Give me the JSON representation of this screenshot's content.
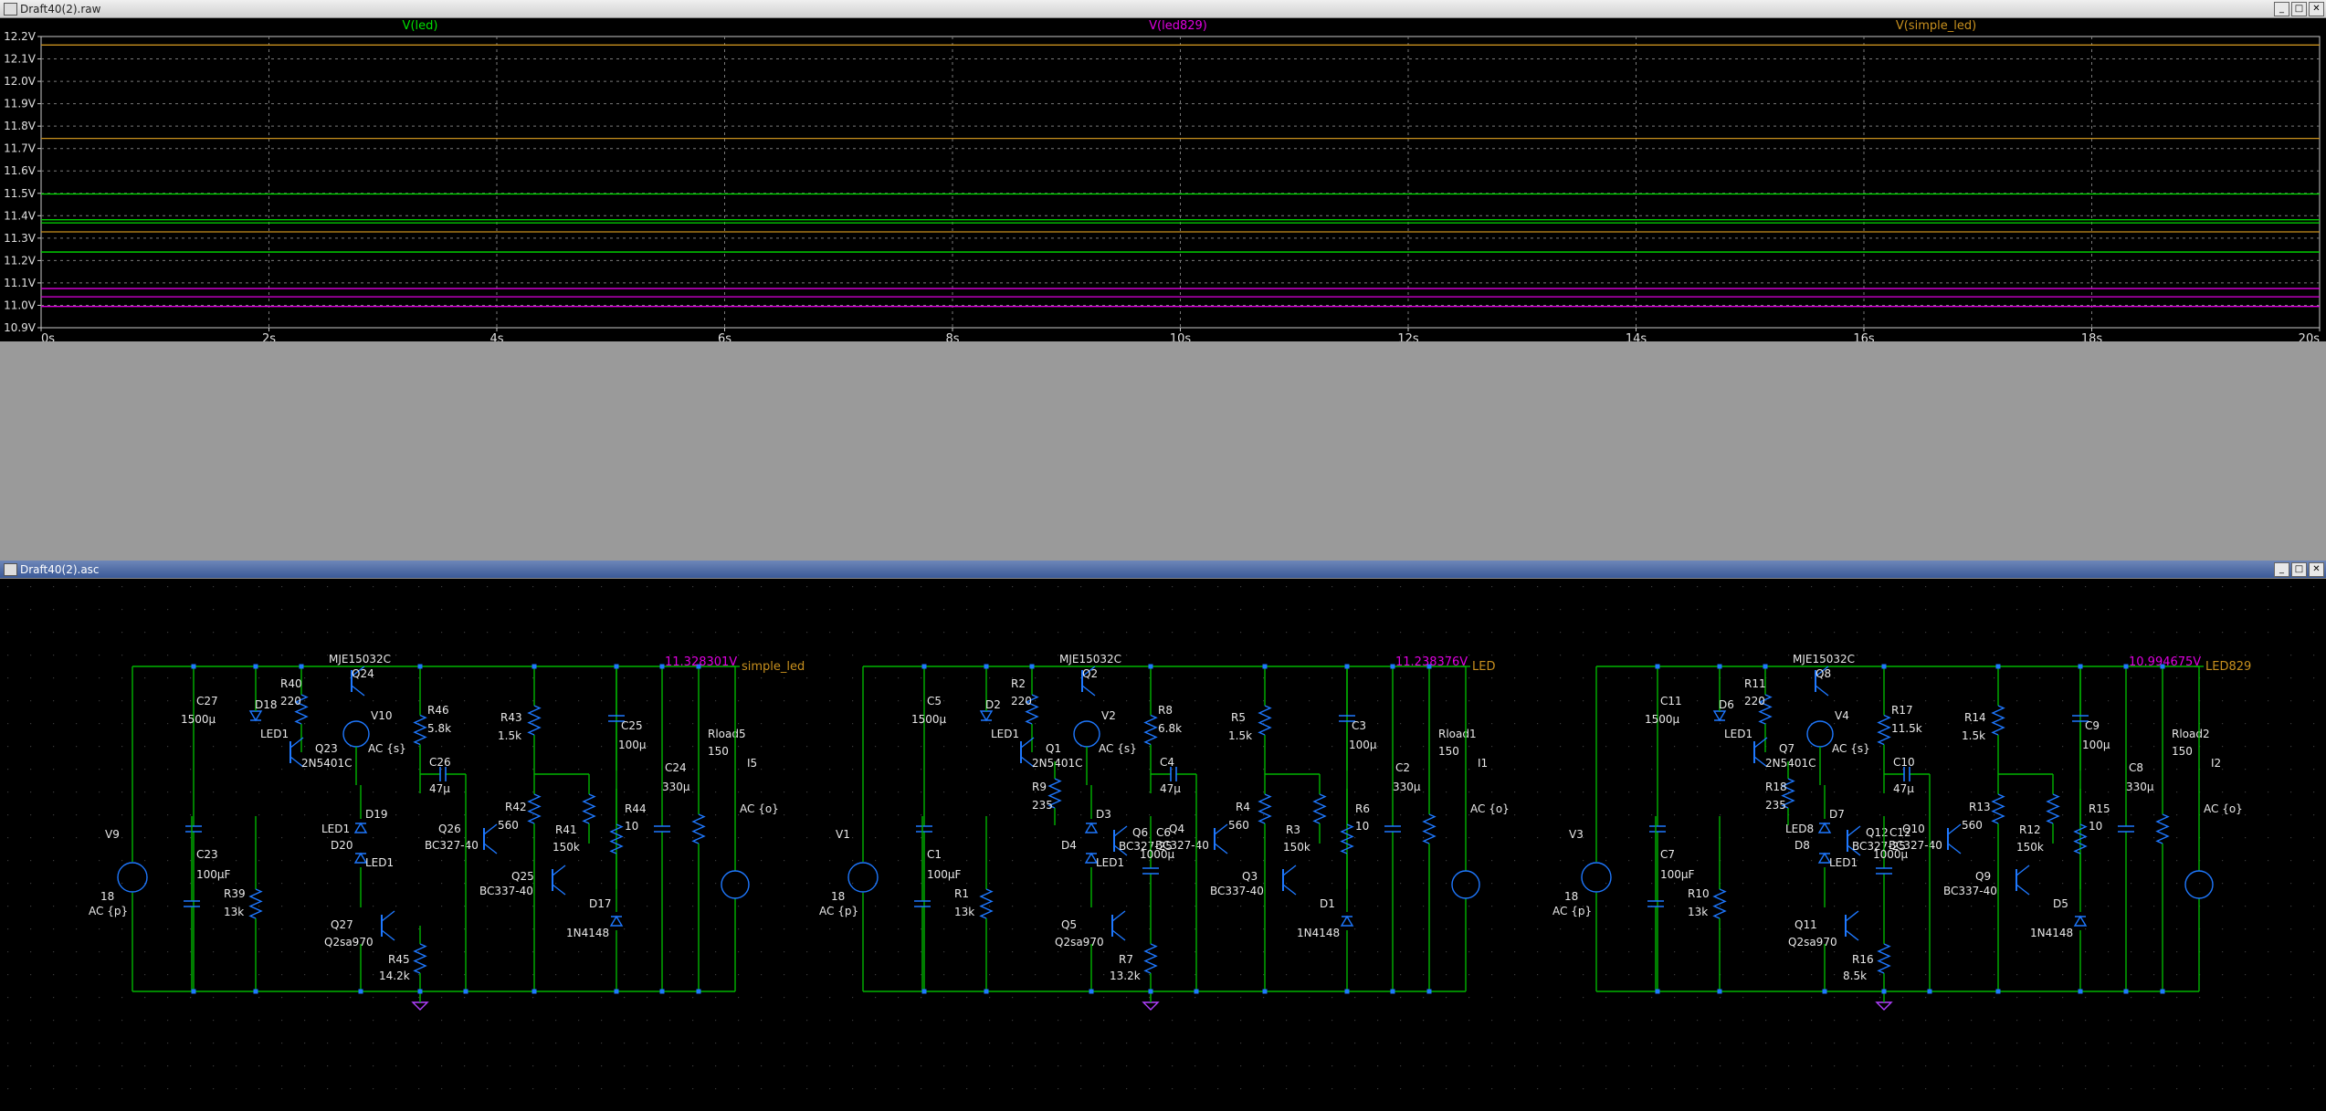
{
  "waveform_window": {
    "title": "Draft40(2).raw",
    "buttons": [
      "_",
      "□",
      "✕"
    ],
    "traces": [
      {
        "name": "V(led)",
        "color": "#00e000"
      },
      {
        "name": "V(led829)",
        "color": "#e000e0"
      },
      {
        "name": "V(simple_led)",
        "color": "#c8901e"
      }
    ]
  },
  "schematic_window": {
    "title": "Draft40(2).asc",
    "buttons": [
      "_",
      "□",
      "✕"
    ],
    "circuits": [
      {
        "vsrc": "V9",
        "vsrc_val": "18",
        "vsrc_ac": "AC {p}",
        "c_in": "C27",
        "c_in_val": "1500µ",
        "c_in2": "C23",
        "c_in2_val": "100µF",
        "led_top": "D18",
        "led_top_lbl": "LED1",
        "r_a": "R40",
        "r_a_val": "220",
        "r_b": "R39",
        "r_b_val": "13k",
        "q_main": "Q24",
        "q_main_type": "MJE15032C",
        "q_drv": "Q23",
        "q_drv_type": "2N5401C",
        "v_src": "V10",
        "v_src_ac": "AC {s}",
        "leds": [
          [
            "D19",
            "LED1"
          ],
          [
            "D20",
            "LED1"
          ]
        ],
        "led_q_lbl": "LED1",
        "q_low": "Q27",
        "q_low_type": "Q2sa970",
        "r_low": "R45",
        "r_low_val": "14.2k",
        "q_mid": "",
        "q_mid_type": "",
        "c_mid": "",
        "c_mid_val": "",
        "r_c": "R46",
        "r_c_val": "5.8k",
        "c_a": "C26",
        "c_a_val": "47µ",
        "q_pnp": "Q26",
        "q_pnp_type": "BC327-40",
        "r_d": "R42",
        "r_d_val": "560",
        "r_e": "R43",
        "r_e_val": "1.5k",
        "q_npn": "Q25",
        "q_npn_type": "BC337-40",
        "r_f": "R41",
        "r_f_val": "150k",
        "diode": "D17",
        "diode_type": "1N4148",
        "c_b": "C25",
        "c_b_val": "100µ",
        "r_g": "R44",
        "r_g_val": "10",
        "c_out": "C24",
        "c_out_val": "330µ",
        "rload": "Rload5",
        "rload_val": "150",
        "isrc": "I5",
        "isrc_ac": "AC {o}",
        "voltage": "11.328301V",
        "net": "simple_led"
      },
      {
        "vsrc": "V1",
        "vsrc_val": "18",
        "vsrc_ac": "AC {p}",
        "c_in": "C5",
        "c_in_val": "1500µ",
        "c_in2": "C1",
        "c_in2_val": "100µF",
        "led_top": "D2",
        "led_top_lbl": "LED1",
        "r_a": "R2",
        "r_a_val": "220",
        "r_b": "R1",
        "r_b_val": "13k",
        "q_main": "Q2",
        "q_main_type": "MJE15032C",
        "q_drv": "Q1",
        "q_drv_type": "2N5401C",
        "v_src": "V2",
        "v_src_ac": "AC {s}",
        "leds": [
          [
            "D3",
            ""
          ],
          [
            "D4",
            "LED1"
          ]
        ],
        "led_q_lbl": "LED1",
        "q_low": "Q5",
        "q_low_type": "Q2sa970",
        "r_low": "R7",
        "r_low_val": "13.2k",
        "q_mid": "Q6",
        "q_mid_type": "BC327-25",
        "c_mid": "C6",
        "c_mid_val": "1000µ",
        "r_mid": "R9",
        "r_mid_val": "235",
        "r_c": "R8",
        "r_c_val": "6.8k",
        "c_a": "C4",
        "c_a_val": "47µ",
        "q_pnp": "Q4",
        "q_pnp_type": "BC327-40",
        "r_d": "R4",
        "r_d_val": "560",
        "r_e": "R5",
        "r_e_val": "1.5k",
        "q_npn": "Q3",
        "q_npn_type": "BC337-40",
        "r_f": "R3",
        "r_f_val": "150k",
        "diode": "D1",
        "diode_type": "1N4148",
        "c_b": "C3",
        "c_b_val": "100µ",
        "r_g": "R6",
        "r_g_val": "10",
        "c_out": "C2",
        "c_out_val": "330µ",
        "rload": "Rload1",
        "rload_val": "150",
        "isrc": "I1",
        "isrc_ac": "AC {o}",
        "voltage": "11.238376V",
        "net": "LED"
      },
      {
        "vsrc": "V3",
        "vsrc_val": "18",
        "vsrc_ac": "AC {p}",
        "c_in": "C11",
        "c_in_val": "1500µ",
        "c_in2": "C7",
        "c_in2_val": "100µF",
        "led_top": "D6",
        "led_top_lbl": "LED1",
        "r_a": "R11",
        "r_a_val": "220",
        "r_b": "R10",
        "r_b_val": "13k",
        "q_main": "Q8",
        "q_main_type": "MJE15032C",
        "q_drv": "Q7",
        "q_drv_type": "2N5401C",
        "v_src": "V4",
        "v_src_ac": "AC {s}",
        "leds": [
          [
            "D7",
            "LED8"
          ],
          [
            "D8",
            "LED1"
          ]
        ],
        "led_q_lbl": "LED1",
        "q_low": "Q11",
        "q_low_type": "Q2sa970",
        "r_low": "R16",
        "r_low_val": "8.5k",
        "q_mid": "Q12",
        "q_mid_type": "BC327-25",
        "c_mid": "C12",
        "c_mid_val": "1000µ",
        "r_mid": "R18",
        "r_mid_val": "235",
        "r_c": "R17",
        "r_c_val": "11.5k",
        "c_a": "C10",
        "c_a_val": "47µ",
        "q_pnp": "Q10",
        "q_pnp_type": "BC327-40",
        "r_d": "R13",
        "r_d_val": "560",
        "r_e": "R14",
        "r_e_val": "1.5k",
        "q_npn": "Q9",
        "q_npn_type": "BC337-40",
        "r_f": "R12",
        "r_f_val": "150k",
        "diode": "D5",
        "diode_type": "1N4148",
        "c_b": "C9",
        "c_b_val": "100µ",
        "r_g": "R15",
        "r_g_val": "10",
        "c_out": "C8",
        "c_out_val": "330µ",
        "rload": "Rload2",
        "rload_val": "150",
        "isrc": "I2",
        "isrc_ac": "AC {o}",
        "voltage": "10.994675V",
        "net": "LED829"
      }
    ]
  },
  "chart_data": {
    "type": "line",
    "title": "",
    "xlabel": "",
    "ylabel": "",
    "xlim": [
      0,
      20
    ],
    "ylim": [
      10.9,
      12.2
    ],
    "x_ticks": [
      "0s",
      "2s",
      "4s",
      "6s",
      "8s",
      "10s",
      "12s",
      "14s",
      "16s",
      "18s",
      "20s"
    ],
    "y_ticks": [
      "10.9V",
      "11.0V",
      "11.1V",
      "11.2V",
      "11.3V",
      "11.4V",
      "11.5V",
      "11.6V",
      "11.7V",
      "11.8V",
      "11.9V",
      "12.0V",
      "12.1V",
      "12.2V"
    ],
    "grid": true,
    "series": [
      {
        "name": "V(led)",
        "color": "#00e000",
        "levels": [
          11.497,
          11.382,
          11.368,
          11.238
        ]
      },
      {
        "name": "V(led829)",
        "color": "#e000e0",
        "levels": [
          11.075,
          11.038,
          10.995
        ]
      },
      {
        "name": "V(simple_led)",
        "color": "#c8901e",
        "levels": [
          12.162,
          11.745,
          11.328
        ]
      }
    ]
  }
}
